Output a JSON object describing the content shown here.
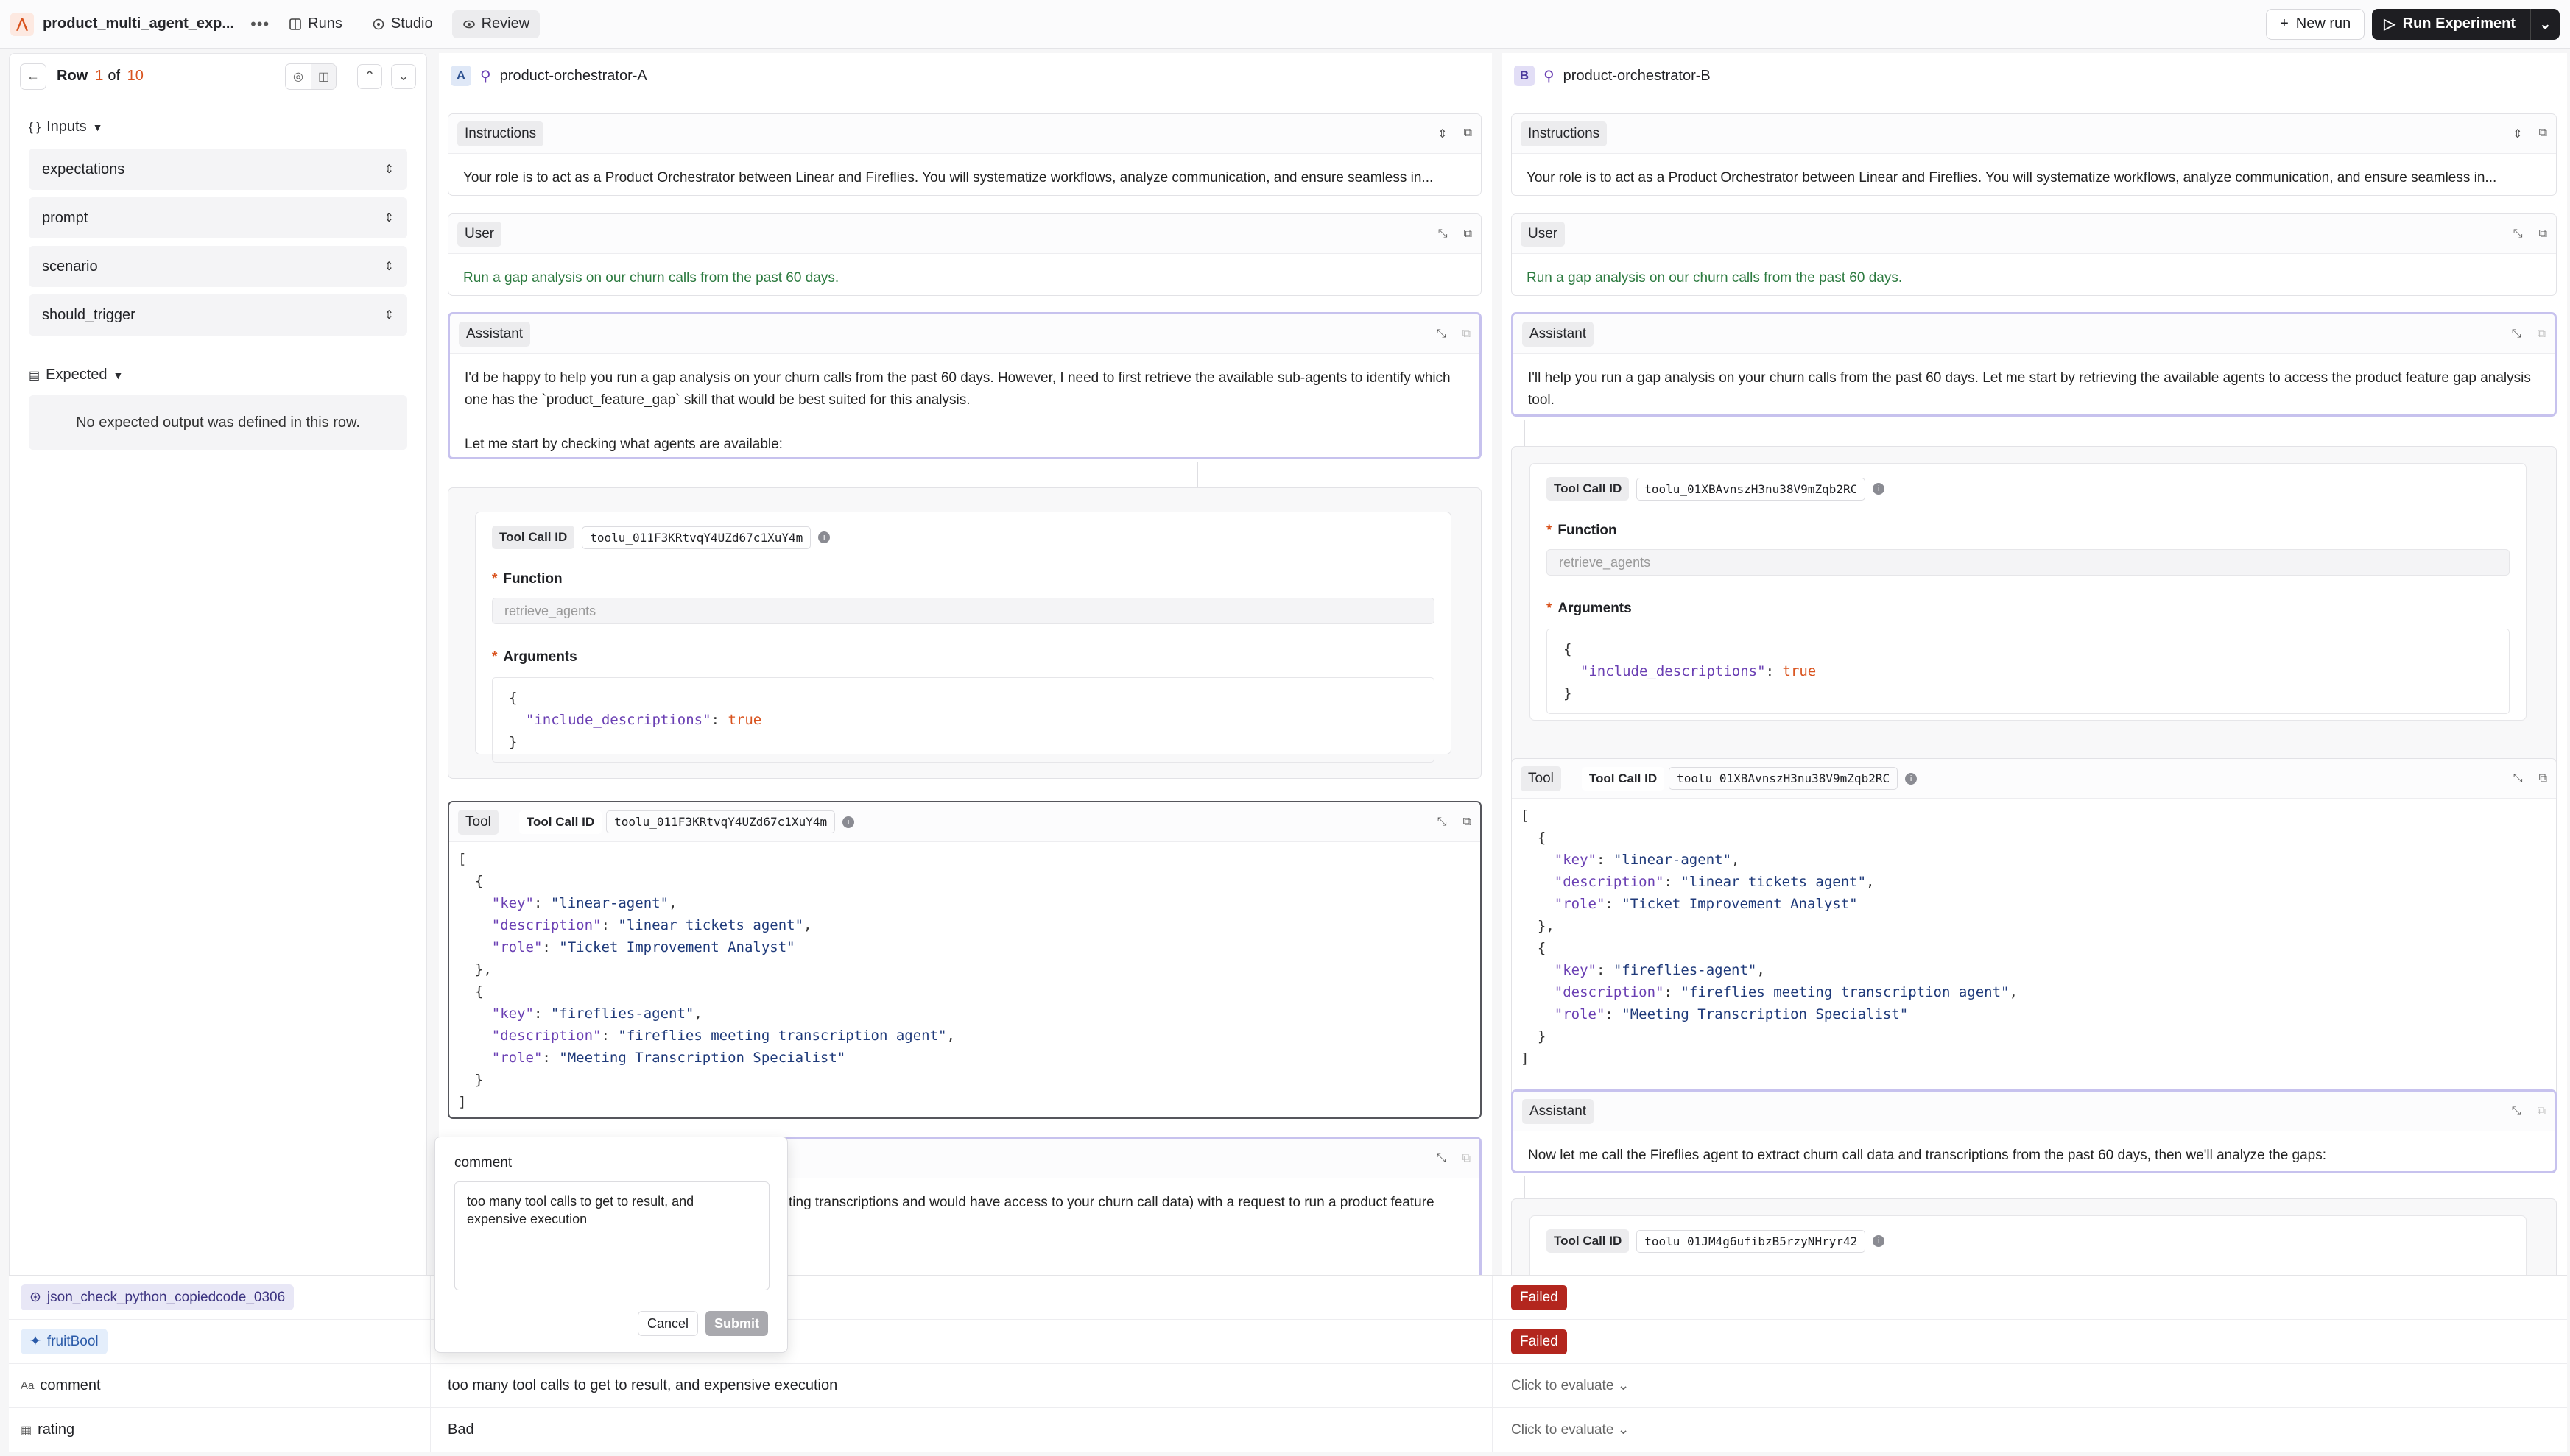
{
  "topbar": {
    "project": "product_multi_agent_exp...",
    "tabs": [
      {
        "label": "Runs"
      },
      {
        "label": "Studio"
      },
      {
        "label": "Review"
      }
    ],
    "new_run": "New run",
    "run_experiment": "Run Experiment"
  },
  "left": {
    "row_label": "Row",
    "row_current": "1",
    "row_of": "of",
    "row_total": "10",
    "inputs_title": "Inputs",
    "inputs": [
      "expectations",
      "prompt",
      "scenario",
      "should_trigger"
    ],
    "expected_title": "Expected",
    "no_expected": "No expected output was defined in this row."
  },
  "colA": {
    "badge": "A",
    "title": "product-orchestrator-A",
    "instructions_tag": "Instructions",
    "instructions": "Your role is to act as a Product Orchestrator between Linear and Fireflies. You will systematize workflows, analyze communication, and ensure seamless in...",
    "user_tag": "User",
    "user_msg": "Run a gap analysis on our churn calls from the past 60 days.",
    "assistant_tag": "Assistant",
    "assistant_p1": "I'd be happy to help you run a gap analysis on your churn calls from the past 60 days. However, I need to first retrieve the available sub-agents to identify which one has the `product_feature_gap` skill that would be best suited for this analysis.",
    "assistant_p2": "Let me start by checking what agents are available:",
    "tool_call_id_label": "Tool Call ID",
    "tool_call_id": "toolu_011F3KRtvqY4UZd67c1XuY4m",
    "function_label": "Function",
    "function_name": "retrieve_agents",
    "arguments_label": "Arguments",
    "arg_key": "\"include_descriptions\"",
    "arg_val": "true",
    "tool_tag": "Tool",
    "json": {
      "k": "\"key\"",
      "d": "\"description\"",
      "r": "\"role\"",
      "v1k": "\"linear-agent\"",
      "v1d": "\"linear tickets agent\"",
      "v1r": "\"Ticket Improvement Analyst\"",
      "v2k": "\"fireflies-agent\"",
      "v2d": "\"fireflies meeting transcription agent\"",
      "v2r": "\"Meeting Transcription Specialist\""
    },
    "partial_text": "ting transcriptions and would have access to your churn call data) with a request to run a product feature"
  },
  "colB": {
    "badge": "B",
    "title": "product-orchestrator-B",
    "instructions_tag": "Instructions",
    "instructions": "Your role is to act as a Product Orchestrator between Linear and Fireflies. You will systematize workflows, analyze communication, and ensure seamless in...",
    "user_tag": "User",
    "user_msg": "Run a gap analysis on our churn calls from the past 60 days.",
    "assistant_tag": "Assistant",
    "assistant_p1": "I'll help you run a gap analysis on your churn calls from the past 60 days. Let me start by retrieving the available agents to access the product feature gap analysis tool.",
    "tool_call_id_label": "Tool Call ID",
    "tool_call_id": "toolu_01XBAvnszH3nu38V9mZqb2RC",
    "function_label": "Function",
    "function_name": "retrieve_agents",
    "arguments_label": "Arguments",
    "arg_key": "\"include_descriptions\"",
    "arg_val": "true",
    "tool_tag": "Tool",
    "assistant2_tag": "Assistant",
    "assistant2": "Now let me call the Fireflies agent to extract churn call data and transcriptions from the past 60 days, then we'll analyze the gaps:",
    "tool_call_id2": "toolu_01JM4g6ufibzB5rzyNHryr42"
  },
  "bottom": {
    "scorer1": "json_check_python_copiedcode_0306",
    "scorer2": "fruitBool",
    "failed": "Failed",
    "comment_label": "comment",
    "comment_value": "too many tool calls to get to result, and expensive execution",
    "rating_label": "rating",
    "rating_value": "Bad",
    "click_eval": "Click to evaluate"
  },
  "popover": {
    "label": "comment",
    "text": "too many tool calls to get to result, and expensive execution",
    "cancel": "Cancel",
    "submit": "Submit"
  }
}
